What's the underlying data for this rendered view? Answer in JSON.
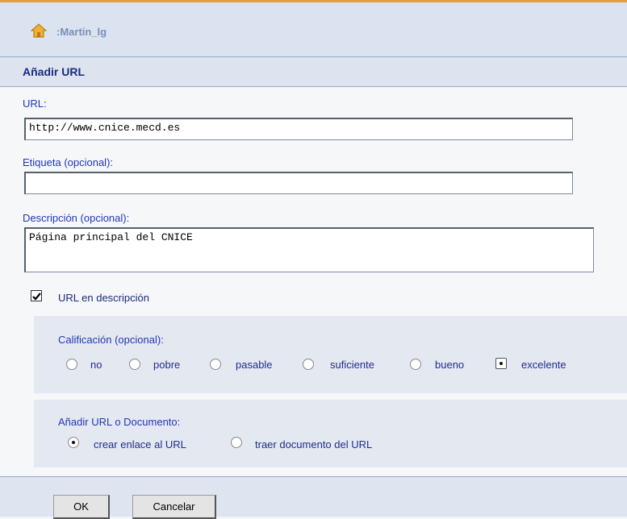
{
  "header": {
    "username": ":Martin_lg",
    "icon": "home-icon"
  },
  "title": "Añadir URL",
  "form": {
    "url": {
      "label": "URL:",
      "value": "http://www.cnice.mecd.es"
    },
    "tag": {
      "label": "Etiqueta (opcional):",
      "value": ""
    },
    "description": {
      "label": "Descripción (opcional):",
      "value": "Página principal del CNICE"
    },
    "url_in_description": {
      "label": "URL en descripción",
      "checked": true
    }
  },
  "rating": {
    "label": "Calificación (opcional):",
    "options": [
      "no",
      "pobre",
      "pasable",
      "suficiente",
      "bueno",
      "excelente"
    ],
    "selected": "excelente"
  },
  "add_type": {
    "label": "Añadir URL o Documento:",
    "options": [
      "crear enlace al URL",
      "traer documento del URL"
    ],
    "selected": "crear enlace al URL"
  },
  "buttons": {
    "ok": "OK",
    "cancel": "Cancelar"
  }
}
